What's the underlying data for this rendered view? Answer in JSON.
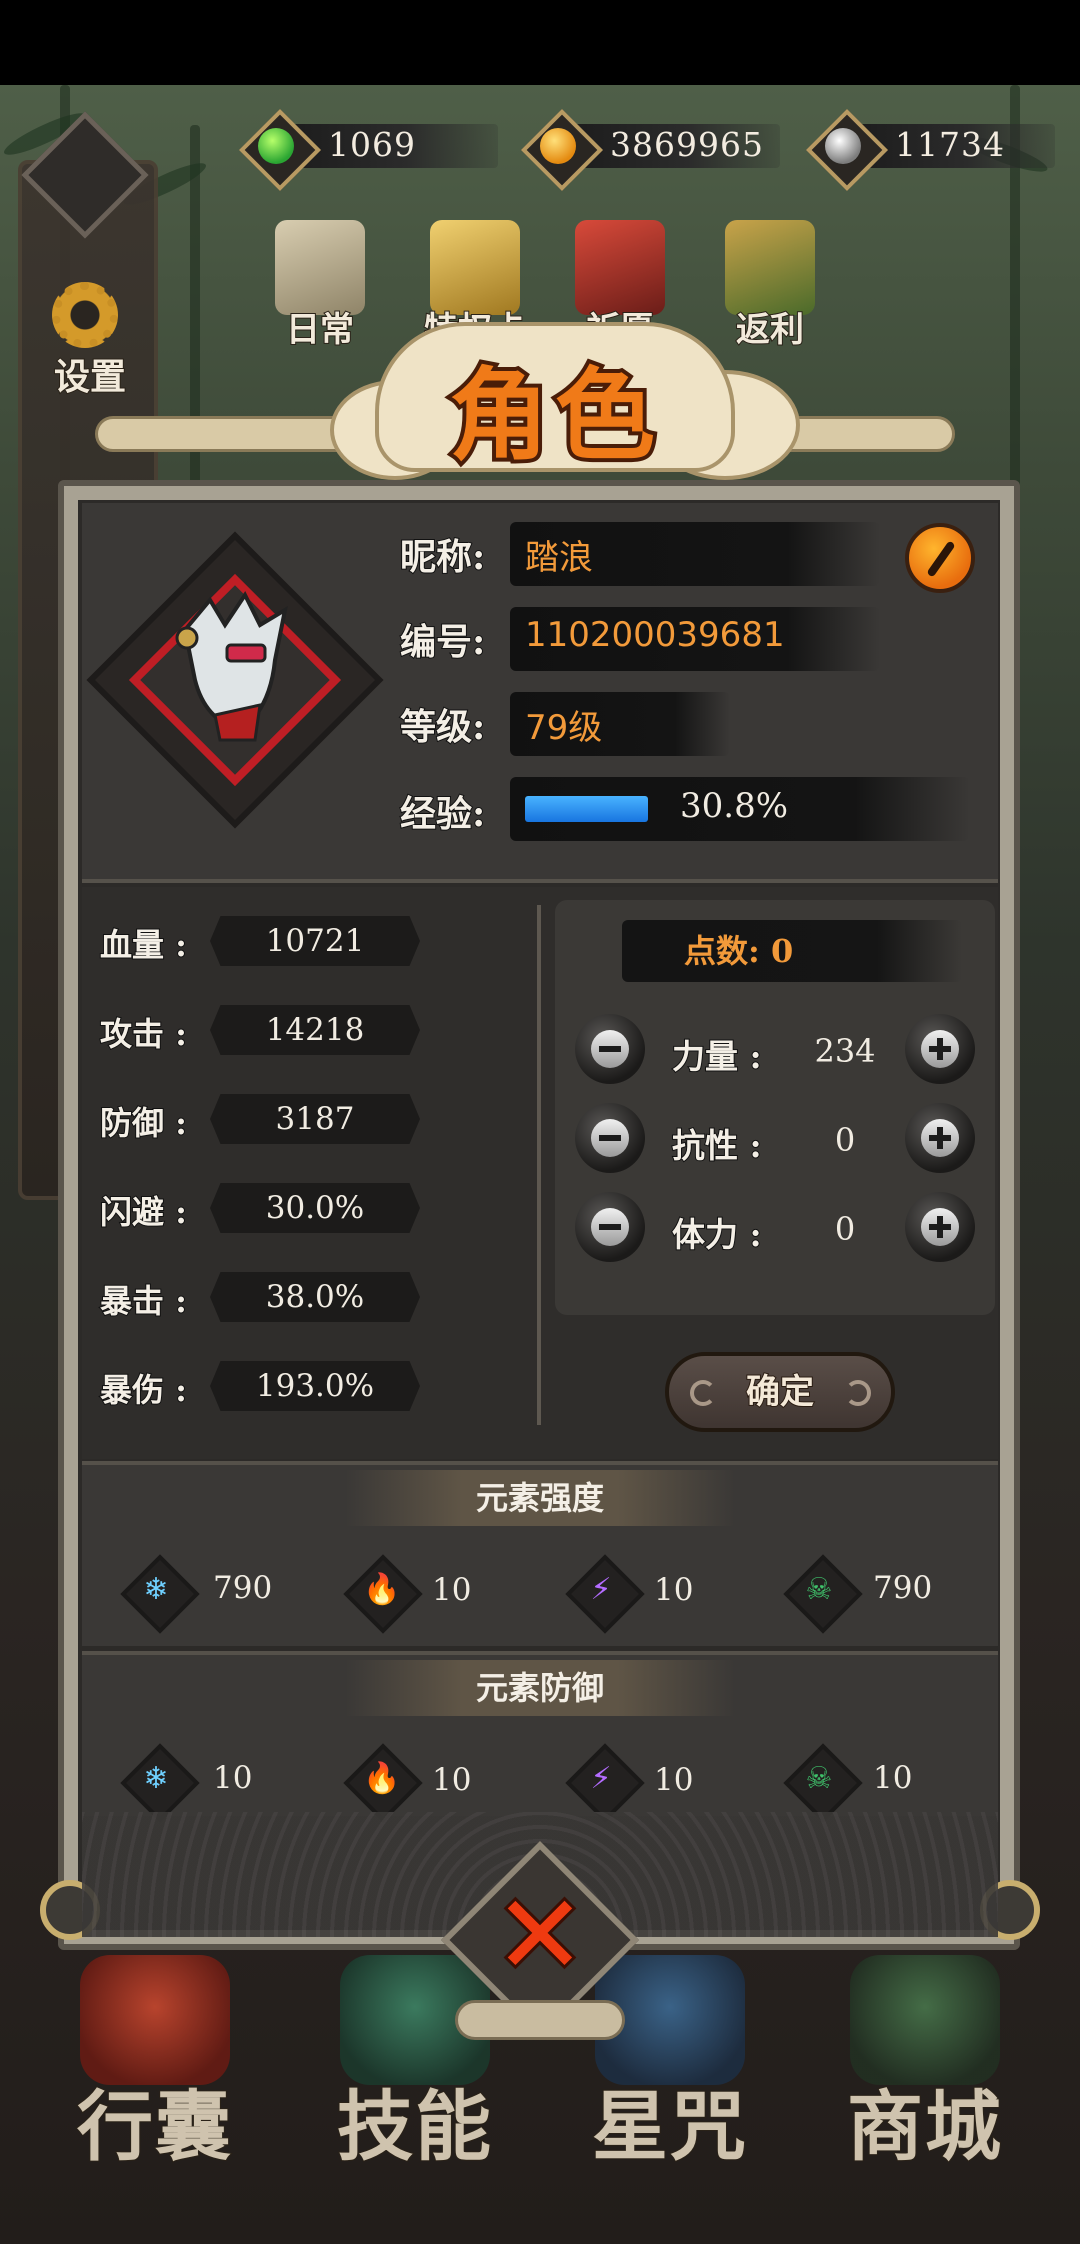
{
  "currencies": [
    {
      "icon": "green-flame-icon",
      "value": "1069",
      "color": "#3fbf3a"
    },
    {
      "icon": "gold-coin-icon",
      "value": "3869965",
      "color": "#f2a41c"
    },
    {
      "icon": "silver-coin-icon",
      "value": "11734",
      "color": "#bfbfbf"
    }
  ],
  "side": {
    "settings_label": "设置"
  },
  "events": [
    {
      "label": "日常",
      "icon": "scroll-icon"
    },
    {
      "label": "特权卡",
      "icon": "privilege-card-icon"
    },
    {
      "label": "祈愿",
      "icon": "torii-gate-icon"
    },
    {
      "label": "返利",
      "icon": "treasure-chest-icon"
    }
  ],
  "title": "角色",
  "profile": {
    "nickname_label": "昵称:",
    "nickname": "踏浪",
    "id_label": "编号:",
    "id": "110200039681",
    "level_label": "等级:",
    "level": "79级",
    "exp_label": "经验:",
    "exp_text": "30.8%",
    "exp_fraction": 0.308
  },
  "stats": [
    {
      "label": "血量 :",
      "value": "10721"
    },
    {
      "label": "攻击 :",
      "value": "14218"
    },
    {
      "label": "防御 :",
      "value": "3187"
    },
    {
      "label": "闪避 :",
      "value": "30.0%"
    },
    {
      "label": "暴击 :",
      "value": "38.0%"
    },
    {
      "label": "暴伤 :",
      "value": "193.0%"
    }
  ],
  "points": {
    "title": "点数: 0",
    "attributes": [
      {
        "label": "力量 :",
        "value": "234"
      },
      {
        "label": "抗性 :",
        "value": "0"
      },
      {
        "label": "体力 :",
        "value": "0"
      }
    ],
    "confirm_label": "确定"
  },
  "element_strength": {
    "title": "元素强度",
    "items": [
      {
        "icon": "ice-icon",
        "glyph": "❄",
        "color": "#6fd0ff",
        "value": "790"
      },
      {
        "icon": "fire-icon",
        "glyph": "🔥",
        "color": "#f58a1f",
        "value": "10"
      },
      {
        "icon": "lightning-icon",
        "glyph": "⚡",
        "color": "#b46cff",
        "value": "10"
      },
      {
        "icon": "poison-skull-icon",
        "glyph": "☠",
        "color": "#3fc06a",
        "value": "790"
      }
    ]
  },
  "element_defense": {
    "title": "元素防御",
    "items": [
      {
        "icon": "ice-icon",
        "glyph": "❄",
        "color": "#6fd0ff",
        "value": "10"
      },
      {
        "icon": "fire-icon",
        "glyph": "🔥",
        "color": "#f58a1f",
        "value": "10"
      },
      {
        "icon": "lightning-icon",
        "glyph": "⚡",
        "color": "#b46cff",
        "value": "10"
      },
      {
        "icon": "poison-skull-icon",
        "glyph": "☠",
        "color": "#3fc06a",
        "value": "10"
      }
    ]
  },
  "nav": [
    {
      "label": "行囊",
      "icon": "bag-icon"
    },
    {
      "label": "技能",
      "icon": "skill-icon"
    },
    {
      "label": "星咒",
      "icon": "star-map-icon"
    },
    {
      "label": "商城",
      "icon": "shop-icon"
    }
  ]
}
